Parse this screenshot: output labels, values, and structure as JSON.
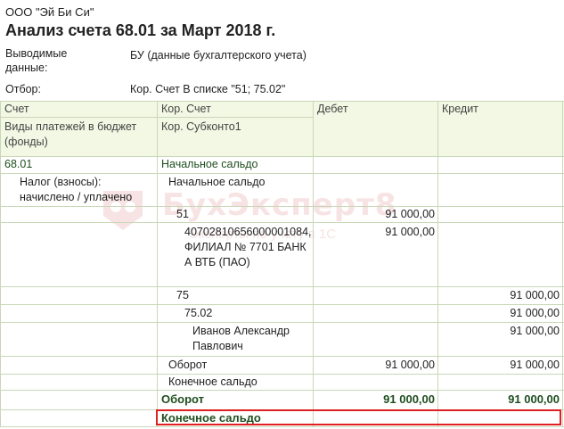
{
  "report": {
    "organization": "ООО \"Эй Би Си\"",
    "title": "Анализ счета 68.01 за Март 2018 г.",
    "output_label": "Выводимые данные:",
    "output_value": "БУ (данные бухгалтерского учета)",
    "filter_label": "Отбор:",
    "filter_value": "Кор. Счет В списке \"51; 75.02\""
  },
  "table": {
    "headers": {
      "account": "Счет",
      "payment_types": "Виды платежей в бюджет (фонды)",
      "corr_account": "Кор. Счет",
      "corr_subconto": "Кор. Субконто1",
      "debit": "Дебет",
      "credit": "Кредит"
    },
    "rows": [
      {
        "col1": "68.01",
        "col2": "Начальное сальдо",
        "debit": "",
        "credit": ""
      },
      {
        "col1": "Налог (взносы): начислено / уплачено",
        "col2": "Начальное сальдо",
        "debit": "",
        "credit": ""
      },
      {
        "col1": "",
        "col2": "51",
        "debit": "91 000,00",
        "credit": ""
      },
      {
        "col1": "",
        "col2": "40702810656000001084, ФИЛИАЛ № 7701 БАНКА ВТБ (ПАО)",
        "debit": "91 000,00",
        "credit": ""
      },
      {
        "col1": "",
        "col2": "75",
        "debit": "",
        "credit": "91 000,00"
      },
      {
        "col1": "",
        "col2": "75.02",
        "debit": "",
        "credit": "91 000,00"
      },
      {
        "col1": "",
        "col2": "Иванов Александр Павлович",
        "debit": "",
        "credit": "91 000,00"
      },
      {
        "col1": "",
        "col2": "Оборот",
        "debit": "91 000,00",
        "credit": "91 000,00"
      },
      {
        "col1": "",
        "col2": "Конечное сальдо",
        "debit": "",
        "credit": ""
      },
      {
        "col1": "",
        "col2": "Оборот",
        "debit": "91 000,00",
        "credit": "91 000,00"
      },
      {
        "col1": "",
        "col2": "Конечное сальдо",
        "debit": "",
        "credit": ""
      }
    ]
  },
  "watermark": {
    "brand": "БухЭксперт8",
    "tagline": "Эксперты по учету в 1С"
  },
  "colors": {
    "grid": "#c9d7b8",
    "header_bg": "#f2f8e4",
    "highlight": "#e02020",
    "total_text": "#1f4f1f"
  }
}
